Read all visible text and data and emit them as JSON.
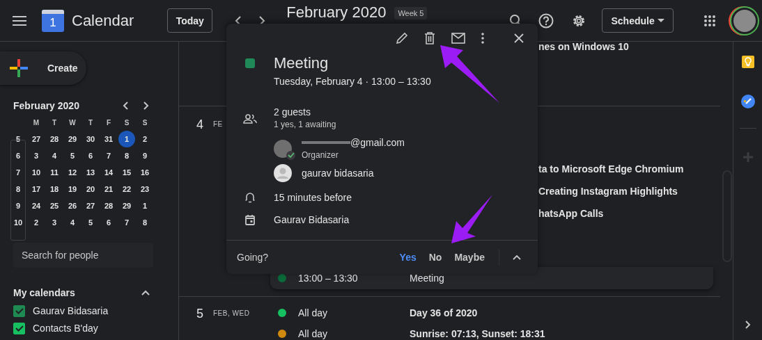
{
  "header": {
    "app_name": "Calendar",
    "logo_text": "1",
    "today": "Today",
    "period": "February 2020",
    "week_badge": "Week 5",
    "view": "Schedule"
  },
  "sidebar": {
    "create": "Create",
    "mini_calendar": {
      "title": "February 2020",
      "weekdays": [
        "M",
        "T",
        "W",
        "T",
        "F",
        "S",
        "S"
      ],
      "weeks": [
        {
          "week": "5",
          "days": [
            {
              "text": "27",
              "selected": false
            },
            {
              "text": "28",
              "selected": false
            },
            {
              "text": "29",
              "selected": false
            },
            {
              "text": "30",
              "selected": false
            },
            {
              "text": "31",
              "selected": false
            },
            {
              "text": "1",
              "selected": true
            },
            {
              "text": "2",
              "selected": false
            }
          ]
        },
        {
          "week": "6",
          "days": [
            {
              "text": "3",
              "selected": false
            },
            {
              "text": "4",
              "selected": false
            },
            {
              "text": "5",
              "selected": false
            },
            {
              "text": "6",
              "selected": false
            },
            {
              "text": "7",
              "selected": false
            },
            {
              "text": "8",
              "selected": false
            },
            {
              "text": "9",
              "selected": false
            }
          ]
        },
        {
          "week": "7",
          "days": [
            {
              "text": "10",
              "selected": false
            },
            {
              "text": "11",
              "selected": false
            },
            {
              "text": "12",
              "selected": false
            },
            {
              "text": "13",
              "selected": false
            },
            {
              "text": "14",
              "selected": false
            },
            {
              "text": "15",
              "selected": false
            },
            {
              "text": "16",
              "selected": false
            }
          ]
        },
        {
          "week": "8",
          "days": [
            {
              "text": "17",
              "selected": false
            },
            {
              "text": "18",
              "selected": false
            },
            {
              "text": "19",
              "selected": false
            },
            {
              "text": "20",
              "selected": false
            },
            {
              "text": "21",
              "selected": false
            },
            {
              "text": "22",
              "selected": false
            },
            {
              "text": "23",
              "selected": false
            }
          ]
        },
        {
          "week": "9",
          "days": [
            {
              "text": "24",
              "selected": false
            },
            {
              "text": "25",
              "selected": false
            },
            {
              "text": "26",
              "selected": false
            },
            {
              "text": "27",
              "selected": false
            },
            {
              "text": "28",
              "selected": false
            },
            {
              "text": "29",
              "selected": false
            },
            {
              "text": "1",
              "selected": false
            }
          ]
        },
        {
          "week": "10",
          "days": [
            {
              "text": "2",
              "selected": false
            },
            {
              "text": "3",
              "selected": false
            },
            {
              "text": "4",
              "selected": false
            },
            {
              "text": "5",
              "selected": false
            },
            {
              "text": "6",
              "selected": false
            },
            {
              "text": "7",
              "selected": false
            },
            {
              "text": "8",
              "selected": false
            }
          ]
        }
      ]
    },
    "search": {
      "placeholder": "Search for people"
    },
    "my_calendars": {
      "title": "My calendars",
      "expanded": true,
      "items": [
        {
          "name": "Gaurav Bidasaria",
          "checked": true,
          "color": "#1e8a52"
        },
        {
          "name": "Contacts B'day",
          "checked": true,
          "color": "#16c060"
        }
      ]
    }
  },
  "schedule": {
    "sections": [
      {
        "events": [
          {
            "title": "nes on Windows 10",
            "selected": false
          }
        ]
      },
      {
        "day": "4",
        "weekday": "FE",
        "events": [
          {
            "title": "ta to Microsoft Edge Chromium",
            "selected": false
          },
          {
            "title": "Creating Instagram Highlights",
            "selected": false
          },
          {
            "title": "hatsApp Calls",
            "selected": false
          },
          {
            "time": "13:00 – 13:30",
            "title": "Meeting",
            "color": "#0b6b3a",
            "selected": true
          }
        ]
      },
      {
        "day": "5",
        "weekday": "FEB, WED",
        "events": [
          {
            "time": "All day",
            "title": "Day 36 of 2020",
            "color": "#16c060",
            "selected": false
          },
          {
            "time": "All day",
            "title": "Sunrise: 07:13, Sunset: 18:31",
            "color": "#d08a0e",
            "selected": false
          }
        ]
      }
    ]
  },
  "event_popup": {
    "title": "Meeting",
    "color": "#1f8a57",
    "when": "Tuesday, February 4  ·  13:00 – 13:30",
    "guests_count": "2 guests",
    "guests_summary": "1 yes, 1 awaiting",
    "guests": [
      {
        "name": "@gmail.com",
        "role": "Organizer",
        "redacted": true,
        "accepted": true
      },
      {
        "name": "gaurav bidasaria",
        "redacted": false,
        "accepted": false
      }
    ],
    "reminder": "15 minutes before",
    "calendar": "Gaurav Bidasaria",
    "rsvp": {
      "question": "Going?",
      "options": [
        {
          "label": "Yes",
          "selected": true
        },
        {
          "label": "No",
          "selected": false
        },
        {
          "label": "Maybe",
          "selected": false
        }
      ],
      "expanded": true
    }
  }
}
